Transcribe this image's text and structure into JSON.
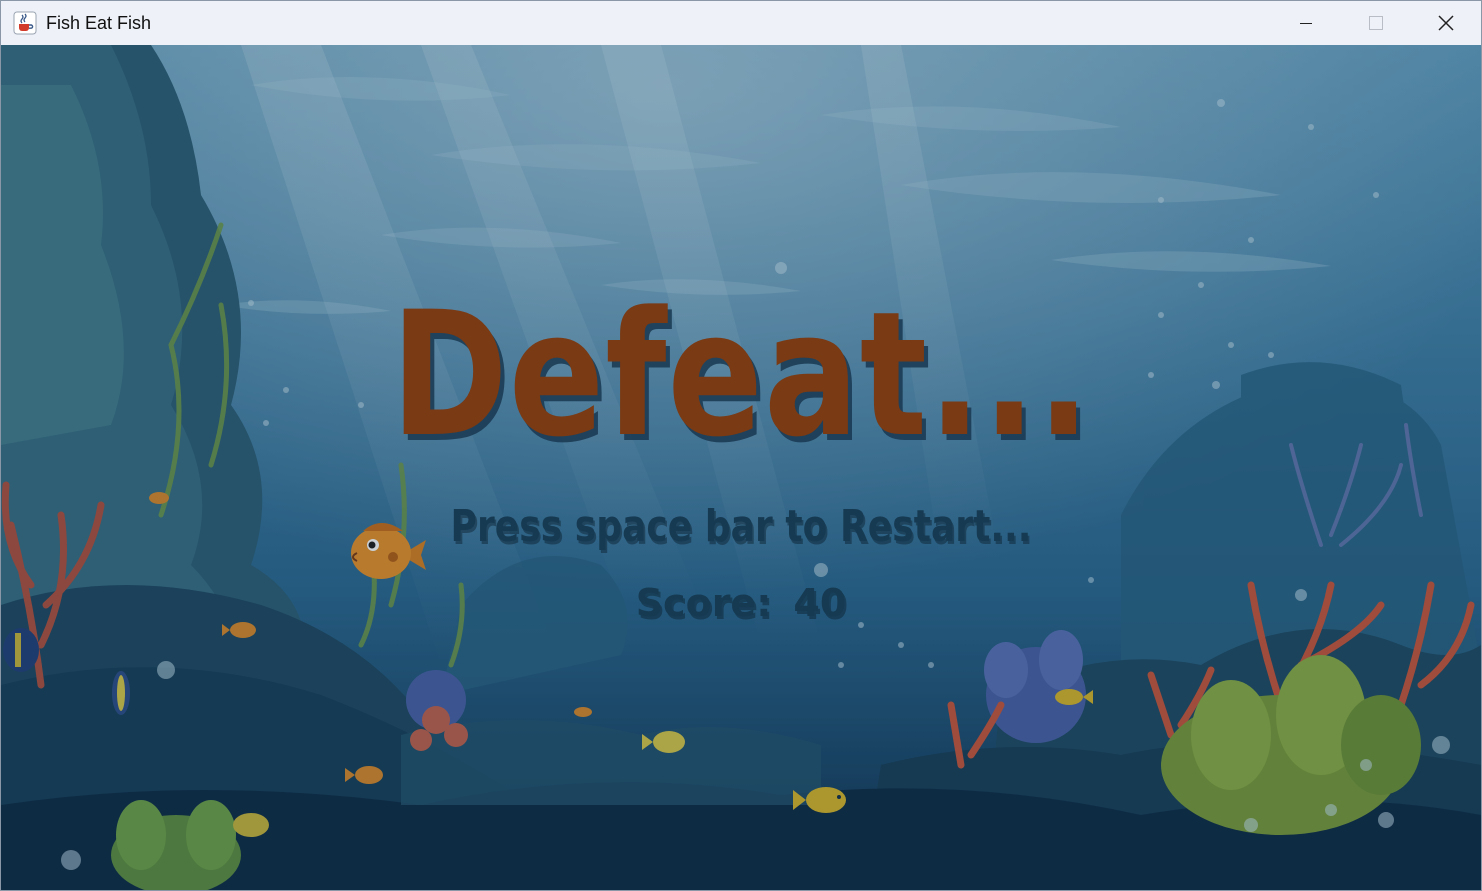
{
  "window": {
    "title": "Fish Eat Fish",
    "icon": "java-cup-icon",
    "controls": [
      "minimize-icon",
      "maximize-icon",
      "close-icon"
    ]
  },
  "game": {
    "heading": "Defeat...",
    "instruction": "Press space bar to Restart...",
    "score_label": "Score:",
    "score_value": "40"
  },
  "colors": {
    "heading": "#7a3a14",
    "text": "#163a52",
    "water_top": "#4f8fb4",
    "water_bottom": "#0f2f4c",
    "titlebar": "#eef1f8"
  }
}
